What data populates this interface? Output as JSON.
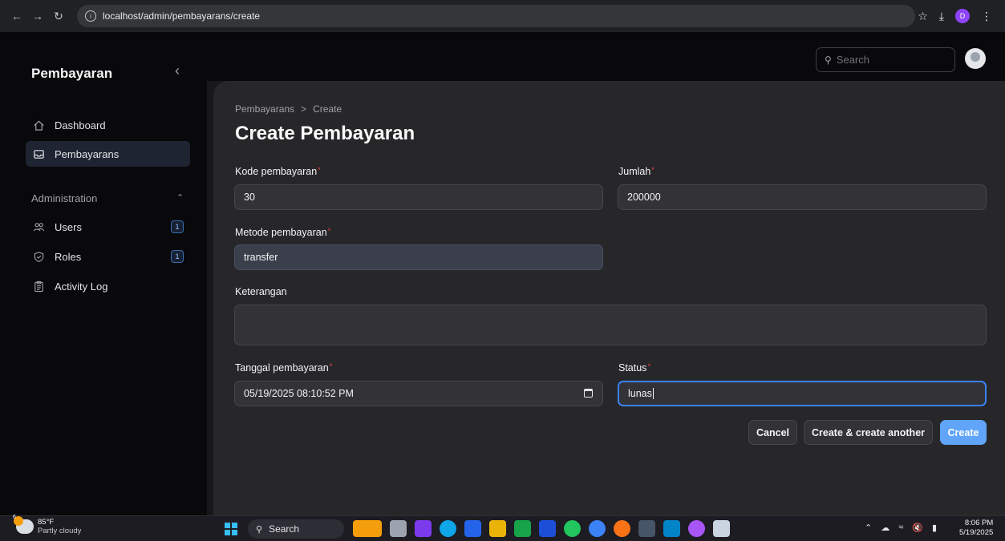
{
  "browser": {
    "url": "localhost/admin/pembayarans/create",
    "profile_initial": "D"
  },
  "sidebar": {
    "brand": "Pembayaran",
    "items": [
      {
        "label": "Dashboard",
        "icon": "home-icon"
      },
      {
        "label": "Pembayarans",
        "icon": "inbox-icon",
        "active": true
      }
    ],
    "group": {
      "label": "Administration",
      "items": [
        {
          "label": "Users",
          "icon": "users-icon",
          "badge": "1"
        },
        {
          "label": "Roles",
          "icon": "shield-icon",
          "badge": "1"
        },
        {
          "label": "Activity Log",
          "icon": "clipboard-icon"
        }
      ]
    }
  },
  "topbar": {
    "search_placeholder": "Search"
  },
  "page": {
    "breadcrumb": [
      "Pembayarans",
      "Create"
    ],
    "breadcrumb_separator": ">",
    "title": "Create Pembayaran"
  },
  "form": {
    "kode_pembayaran": {
      "label": "Kode pembayaran",
      "value": "30",
      "required": true
    },
    "jumlah": {
      "label": "Jumlah",
      "value": "200000",
      "required": true
    },
    "metode_pembayaran": {
      "label": "Metode pembayaran",
      "value": "transfer",
      "required": true
    },
    "keterangan": {
      "label": "Keterangan",
      "value": ""
    },
    "tanggal_pembayaran": {
      "label": "Tanggal pembayaran",
      "value": "05/19/2025 08:10:52 PM",
      "required": true
    },
    "status": {
      "label": "Status",
      "value": "lunas",
      "required": true
    },
    "required_marker": "*"
  },
  "actions": {
    "cancel": "Cancel",
    "create_another": "Create & create another",
    "create": "Create"
  },
  "taskbar": {
    "weather_temp": "85°F",
    "weather_desc": "Partly cloudy",
    "weather_badge": "6",
    "search_label": "Search",
    "time": "8:06 PM",
    "date": "5/19/2025"
  },
  "colors": {
    "accent": "#60a5fa",
    "focus": "#3b82f6",
    "required": "#ef4444"
  }
}
